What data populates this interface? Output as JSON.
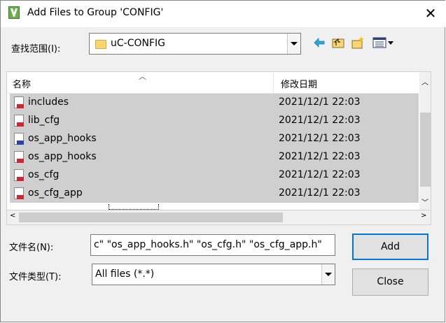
{
  "window": {
    "title": "Add Files to Group 'CONFIG'"
  },
  "look_in": {
    "label": "查找范围(I):",
    "value": "uC-CONFIG"
  },
  "toolbar": {
    "icons": [
      "back-icon",
      "up-folder-icon",
      "new-folder-icon",
      "view-menu-icon"
    ]
  },
  "file_list": {
    "columns": [
      "名称",
      "修改日期"
    ],
    "rows": [
      {
        "name": "includes",
        "date": "2021/12/1 22:03",
        "icon": "file-red-icon"
      },
      {
        "name": "lib_cfg",
        "date": "2021/12/1 22:03",
        "icon": "file-red-icon"
      },
      {
        "name": "os_app_hooks",
        "date": "2021/12/1 22:03",
        "icon": "file-blue-icon"
      },
      {
        "name": "os_app_hooks",
        "date": "2021/12/1 22:03",
        "icon": "file-red-icon"
      },
      {
        "name": "os_cfg",
        "date": "2021/12/1 22:03",
        "icon": "file-red-icon"
      },
      {
        "name": "os_cfg_app",
        "date": "2021/12/1 22:03",
        "icon": "file-red-icon"
      }
    ]
  },
  "filename": {
    "label": "文件名(N):",
    "value": "c\" \"os_app_hooks.h\" \"os_cfg.h\" \"os_cfg_app.h\""
  },
  "filetype": {
    "label": "文件类型(T):",
    "value": "All files (*.*)"
  },
  "buttons": {
    "add": "Add",
    "close": "Close"
  }
}
